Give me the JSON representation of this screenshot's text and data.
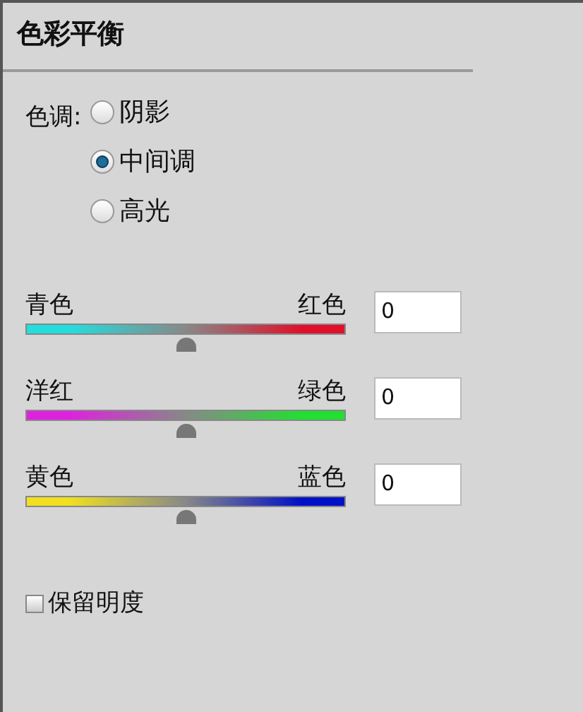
{
  "panel": {
    "title": "色彩平衡"
  },
  "tone": {
    "label": "色调:",
    "options": [
      {
        "label": "阴影",
        "selected": false
      },
      {
        "label": "中间调",
        "selected": true
      },
      {
        "label": "高光",
        "selected": false
      }
    ]
  },
  "sliders": [
    {
      "left_label": "青色",
      "right_label": "红色",
      "ends": [
        {
          "color": "#22dede"
        },
        {
          "color": "#e0102a"
        }
      ],
      "level": 0.5,
      "value": "0"
    },
    {
      "left_label": "洋红",
      "right_label": "绿色",
      "ends": [
        {
          "color": "#e020e0"
        },
        {
          "color": "#20e030"
        }
      ],
      "level": 0.5,
      "value": "0"
    },
    {
      "left_label": "黄色",
      "right_label": "蓝色",
      "ends": [
        {
          "color": "#f0e020"
        },
        {
          "color": "#0010c8"
        }
      ],
      "level": 0.5,
      "value": "0"
    }
  ],
  "preserve_luminosity": {
    "label": "保留明度",
    "checked": false
  }
}
